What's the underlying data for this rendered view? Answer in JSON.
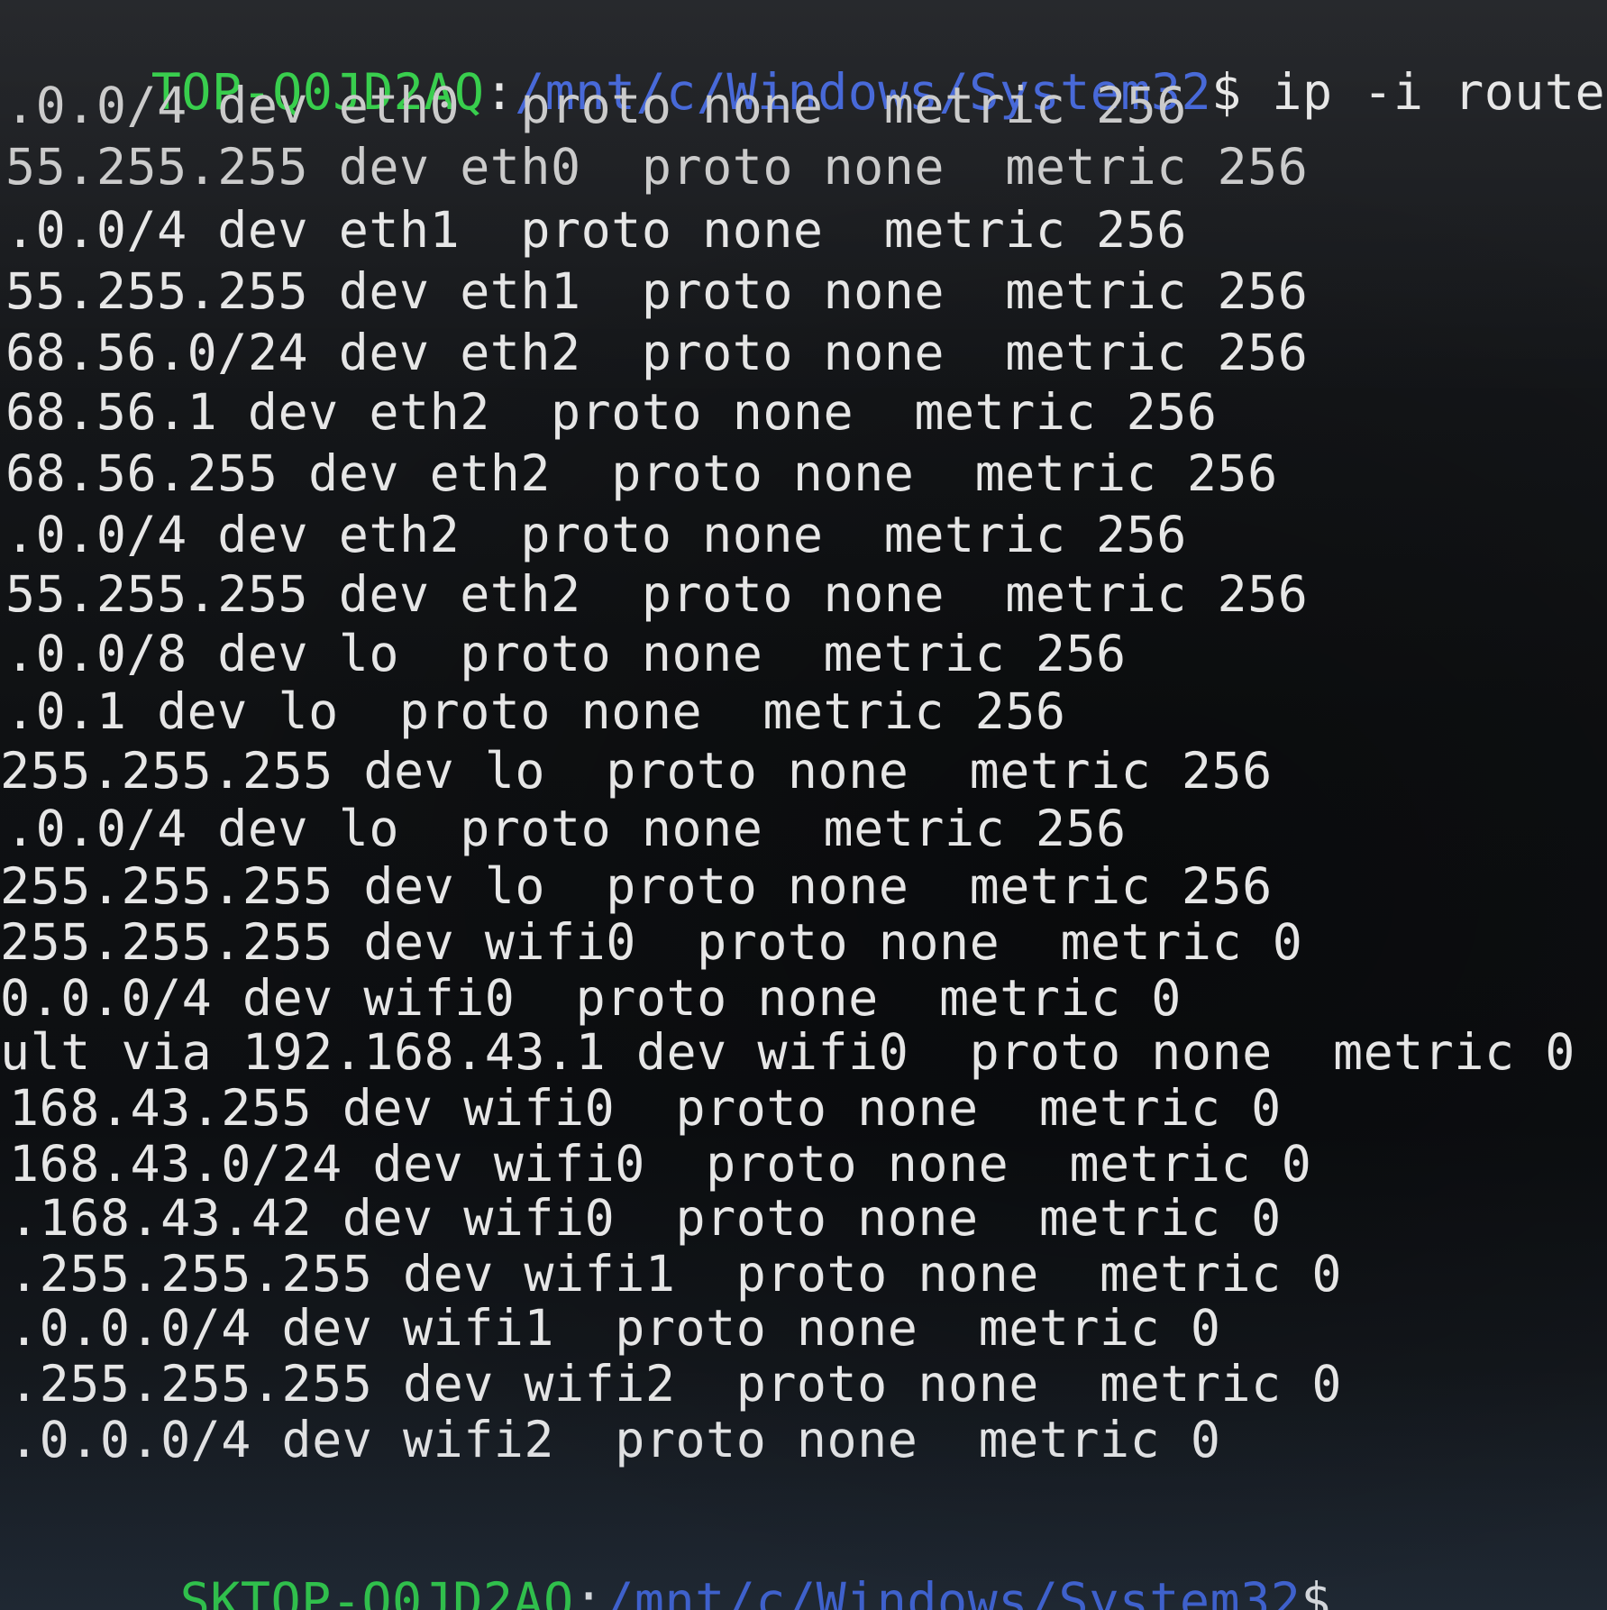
{
  "terminal": {
    "prompt_top": {
      "user": "TOP-Q0JD2AQ",
      "sep": ":",
      "path": "/mnt/c/Windows/System32",
      "dollar": "$",
      "command": " ip -i route"
    },
    "lines": [
      ".0.0/4 dev eth0  proto none  metric 256",
      "55.255.255 dev eth0  proto none  metric 256",
      ".0.0/4 dev eth1  proto none  metric 256",
      "55.255.255 dev eth1  proto none  metric 256",
      "68.56.0/24 dev eth2  proto none  metric 256",
      "68.56.1 dev eth2  proto none  metric 256",
      "68.56.255 dev eth2  proto none  metric 256",
      ".0.0/4 dev eth2  proto none  metric 256",
      "55.255.255 dev eth2  proto none  metric 256",
      ".0.0/8 dev lo  proto none  metric 256",
      ".0.1 dev lo  proto none  metric 256",
      "255.255.255 dev lo  proto none  metric 256",
      ".0.0/4 dev lo  proto none  metric 256",
      "255.255.255 dev lo  proto none  metric 256",
      "255.255.255 dev wifi0  proto none  metric 0",
      "0.0.0/4 dev wifi0  proto none  metric 0",
      "ult via 192.168.43.1 dev wifi0  proto none  metric 0",
      "168.43.255 dev wifi0  proto none  metric 0",
      "168.43.0/24 dev wifi0  proto none  metric 0",
      ".168.43.42 dev wifi0  proto none  metric 0",
      ".255.255.255 dev wifi1  proto none  metric 0",
      ".0.0.0/4 dev wifi1  proto none  metric 0",
      ".255.255.255 dev wifi2  proto none  metric 0",
      ".0.0.0/4 dev wifi2  proto none  metric 0"
    ],
    "prompt_bottom": {
      "user": "SKTOP-Q0JD2AQ",
      "sep": ":",
      "path": "/mnt/c/Windows/System32",
      "dollar": "$"
    }
  },
  "colors": {
    "background": "#121416",
    "text": "#e6e6e6",
    "prompt_user": "#2fcc45",
    "prompt_path": "#3f62d6"
  }
}
